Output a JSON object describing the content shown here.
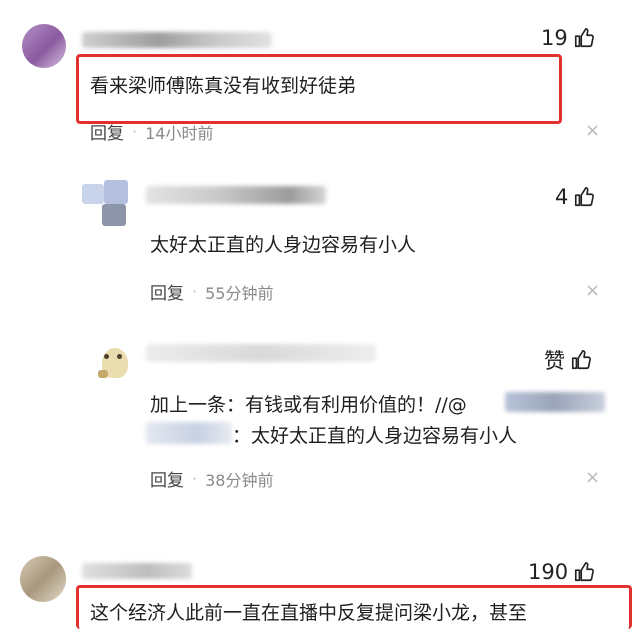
{
  "comments": [
    {
      "text": "看来梁师傅陈真没有收到好徒弟",
      "likes": "19",
      "reply_label": "回复",
      "time": "14小时前",
      "close": "×"
    },
    {
      "text": "太好太正直的人身边容易有小人",
      "likes": "4",
      "reply_label": "回复",
      "time": "55分钟前",
      "close": "×"
    },
    {
      "line1": "加上一条：有钱或有利用价值的！//@",
      "line2": "：太好太正直的人身边容易有小人",
      "likes": "赞",
      "reply_label": "回复",
      "time": "38分钟前",
      "close": "×"
    },
    {
      "text": "这个经济人此前一直在直播中反复提问梁小龙，甚至",
      "likes": "190"
    }
  ],
  "dot": "·",
  "colors": {
    "highlight": "#e0312e",
    "muted": "#8a8a8a"
  }
}
